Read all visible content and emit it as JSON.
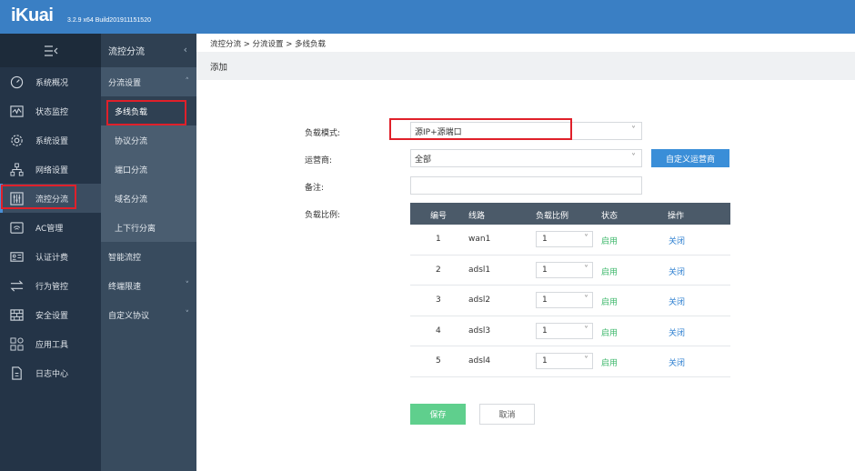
{
  "header": {
    "logo": "iKuai",
    "version": "3.2.9 x64 Build201911151520"
  },
  "sidebar": {
    "collapse_icon": "collapse-menu-icon",
    "items": [
      {
        "label": "系统概况",
        "icon": "dashboard-icon"
      },
      {
        "label": "状态监控",
        "icon": "monitor-pulse-icon"
      },
      {
        "label": "系统设置",
        "icon": "gear-icon"
      },
      {
        "label": "网络设置",
        "icon": "network-tree-icon"
      },
      {
        "label": "流控分流",
        "icon": "sliders-icon",
        "active": true
      },
      {
        "label": "AC管理",
        "icon": "wifi-router-icon"
      },
      {
        "label": "认证计费",
        "icon": "id-card-icon"
      },
      {
        "label": "行为管控",
        "icon": "arrows-swap-icon"
      },
      {
        "label": "安全设置",
        "icon": "firewall-icon"
      },
      {
        "label": "应用工具",
        "icon": "app-grid-icon"
      },
      {
        "label": "日志中心",
        "icon": "document-icon"
      }
    ]
  },
  "submenu": {
    "title": "流控分流",
    "groups": [
      {
        "label": "分流设置"
      },
      {
        "label": "智能流控"
      },
      {
        "label": "终端限速"
      },
      {
        "label": "自定义协议"
      }
    ],
    "subitems": [
      {
        "label": "多线负载"
      },
      {
        "label": "协议分流"
      },
      {
        "label": "端口分流"
      },
      {
        "label": "域名分流"
      },
      {
        "label": "上下行分离"
      }
    ]
  },
  "breadcrumb": "流控分流 > 分流设置 > 多线负载",
  "page_title": "添加",
  "form": {
    "mode_label": "负载模式:",
    "mode_value": "源IP+源端口",
    "isp_label": "运营商:",
    "isp_value": "全部",
    "custom_isp_button": "自定义运营商",
    "note_label": "备注:",
    "note_value": "",
    "ratio_label": "负载比例:"
  },
  "table": {
    "headers": [
      "编号",
      "线路",
      "负载比例",
      "状态",
      "操作"
    ],
    "rows": [
      {
        "id": "1",
        "line": "wan1",
        "ratio": "1",
        "status": "启用",
        "action": "关闭"
      },
      {
        "id": "2",
        "line": "adsl1",
        "ratio": "1",
        "status": "启用",
        "action": "关闭"
      },
      {
        "id": "3",
        "line": "adsl2",
        "ratio": "1",
        "status": "启用",
        "action": "关闭"
      },
      {
        "id": "4",
        "line": "adsl3",
        "ratio": "1",
        "status": "启用",
        "action": "关闭"
      },
      {
        "id": "5",
        "line": "adsl4",
        "ratio": "1",
        "status": "启用",
        "action": "关闭"
      }
    ]
  },
  "buttons": {
    "save": "保存",
    "cancel": "取消"
  },
  "colors": {
    "topbar": "#3a7fc4",
    "sidebar": "#243447",
    "submenu": "#384b5e",
    "save": "#5fcf8d",
    "highlight": "#e0202a"
  }
}
